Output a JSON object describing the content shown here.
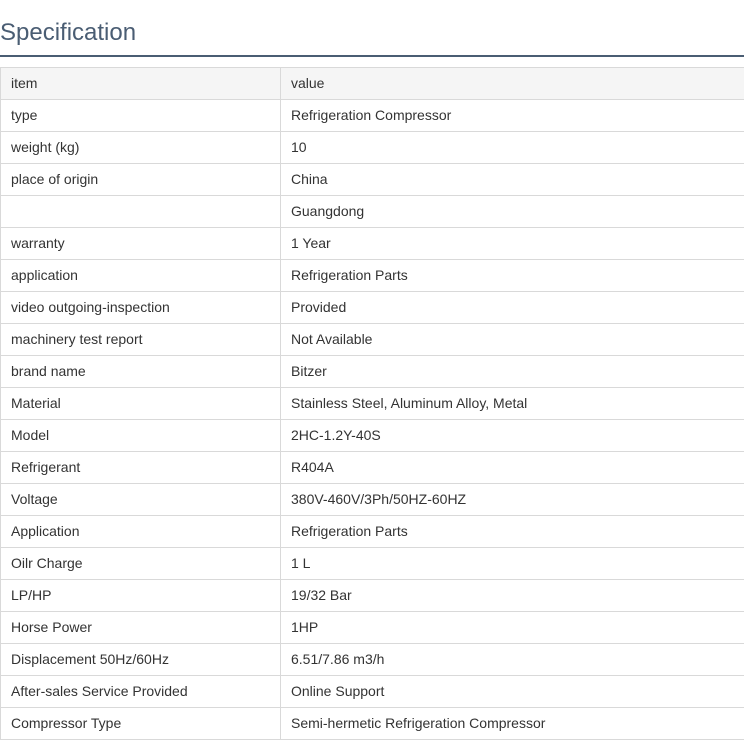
{
  "page": {
    "title": "Specification"
  },
  "table": {
    "header": {
      "item": "item",
      "value": "value"
    },
    "rows": [
      {
        "item": "type",
        "value": "Refrigeration Compressor"
      },
      {
        "item": "weight (kg)",
        "value": "10"
      },
      {
        "item": "place of origin",
        "value": "China"
      },
      {
        "item": "",
        "value": "Guangdong"
      },
      {
        "item": "warranty",
        "value": "1 Year"
      },
      {
        "item": "application",
        "value": "Refrigeration Parts"
      },
      {
        "item": "video outgoing-inspection",
        "value": "Provided"
      },
      {
        "item": "machinery test report",
        "value": "Not Available"
      },
      {
        "item": "brand name",
        "value": "Bitzer"
      },
      {
        "item": "Material",
        "value": "Stainless Steel, Aluminum Alloy, Metal"
      },
      {
        "item": "Model",
        "value": "2HC-1.2Y-40S"
      },
      {
        "item": "Refrigerant",
        "value": "R404A"
      },
      {
        "item": "Voltage",
        "value": "380V-460V/3Ph/50HZ-60HZ"
      },
      {
        "item": "Application",
        "value": "Refrigeration Parts"
      },
      {
        "item": "Oilr Charge",
        "value": "1 L"
      },
      {
        "item": "LP/HP",
        "value": "19/32 Bar"
      },
      {
        "item": "Horse Power",
        "value": "1HP"
      },
      {
        "item": "Displacement 50Hz/60Hz",
        "value": "6.51/7.86 m3/h"
      },
      {
        "item": "After-sales Service Provided",
        "value": "Online Support"
      },
      {
        "item": "Compressor Type",
        "value": "Semi-hermetic Refrigeration Compressor"
      }
    ]
  },
  "colors": {
    "title": "#4a5d73",
    "header_bg": "#f5f5f5",
    "border": "#d9d9d9",
    "text": "#333333"
  }
}
